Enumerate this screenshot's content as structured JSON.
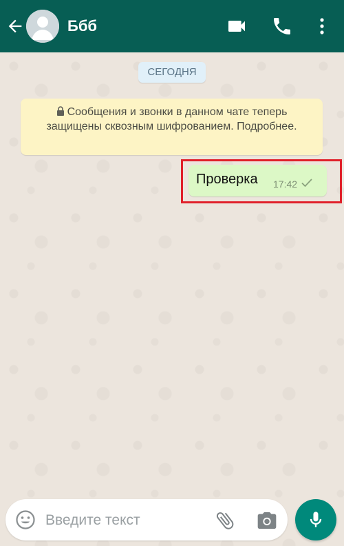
{
  "header": {
    "contact_name": "Ббб"
  },
  "chat": {
    "date_label": "СЕГОДНЯ",
    "encryption_notice": "Сообщения и звонки в данном чате теперь защищены сквозным шифрованием. Подробнее.",
    "messages": [
      {
        "text": "Проверка",
        "time": "17:42",
        "status": "sent-single-check",
        "direction": "outgoing"
      }
    ]
  },
  "composer": {
    "placeholder": "Введите текст",
    "value": ""
  },
  "icons": {
    "back": "arrow-left-icon",
    "avatar": "avatar-person-icon",
    "video": "video-call-icon",
    "phone": "phone-call-icon",
    "menu": "more-vert-icon",
    "lock": "lock-icon",
    "check": "check-icon",
    "emoji": "emoji-icon",
    "attach": "paperclip-icon",
    "camera": "camera-icon",
    "mic": "mic-icon"
  },
  "colors": {
    "header": "#075e54",
    "outgoing_bubble": "#dcf8c6",
    "notice_background": "#fdf4c5",
    "date_chip": "#e1f0f9",
    "mic_button": "#00897b",
    "highlight": "#e0202a"
  }
}
